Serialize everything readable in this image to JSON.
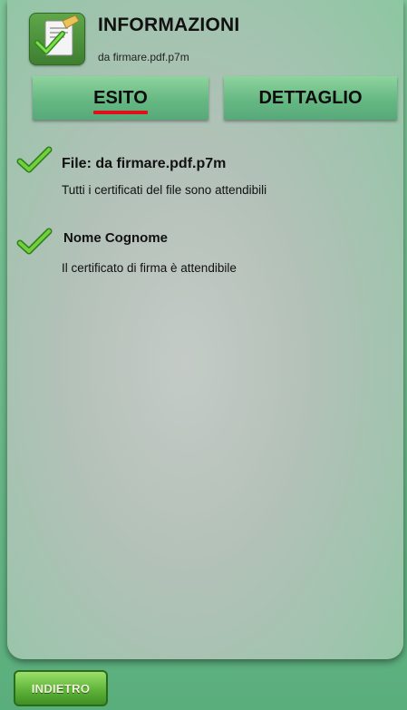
{
  "header": {
    "title": "INFORMAZIONI",
    "subtitle": "da firmare.pdf.p7m",
    "icon": "signed-document-icon"
  },
  "tabs": [
    {
      "label": "ESITO",
      "active": true
    },
    {
      "label": "DETTAGLIO",
      "active": false
    }
  ],
  "results": [
    {
      "icon": "checkmark-icon",
      "title": "File: da firmare.pdf.p7m",
      "description": "Tutti i certificati del file sono attendibili"
    },
    {
      "icon": "checkmark-icon",
      "title": "Nome Cognome",
      "description": "Il certificato di firma è attendibile"
    }
  ],
  "footer": {
    "back_label": "INDIETRO"
  },
  "colors": {
    "accent_underline": "#e0101a",
    "tab_green": "#66b882",
    "check_green": "#4fae2c",
    "back_green": "#5fb43a"
  }
}
